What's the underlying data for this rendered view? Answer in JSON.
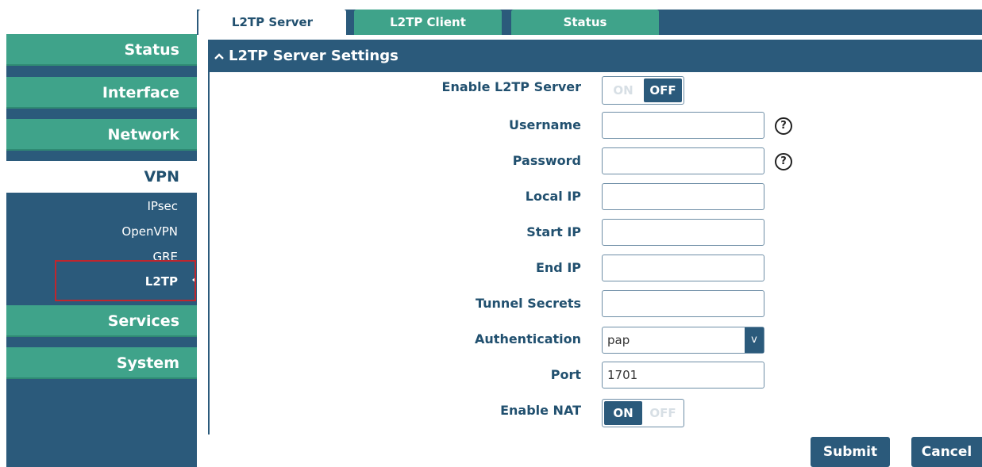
{
  "sidebar": {
    "items": [
      {
        "label": "Status"
      },
      {
        "label": "Interface"
      },
      {
        "label": "Network"
      },
      {
        "label": "VPN"
      },
      {
        "label": "Services"
      },
      {
        "label": "System"
      }
    ],
    "vpn_sub": [
      {
        "label": "IPsec"
      },
      {
        "label": "OpenVPN"
      },
      {
        "label": "GRE"
      },
      {
        "label": "L2TP"
      }
    ]
  },
  "tabs": [
    {
      "label": "L2TP Server"
    },
    {
      "label": "L2TP Client"
    },
    {
      "label": "Status"
    }
  ],
  "section": {
    "title": "L2TP Server Settings",
    "icon": "chevron-up-icon"
  },
  "form": {
    "enable_server": {
      "label": "Enable L2TP Server",
      "on": "ON",
      "off": "OFF",
      "state": "OFF"
    },
    "username": {
      "label": "Username",
      "value": ""
    },
    "password": {
      "label": "Password",
      "value": ""
    },
    "local_ip": {
      "label": "Local IP",
      "value": ""
    },
    "start_ip": {
      "label": "Start IP",
      "value": ""
    },
    "end_ip": {
      "label": "End IP",
      "value": ""
    },
    "tunnel_secrets": {
      "label": "Tunnel Secrets",
      "value": ""
    },
    "authentication": {
      "label": "Authentication",
      "value": "pap"
    },
    "port": {
      "label": "Port",
      "value": "1701"
    },
    "enable_nat": {
      "label": "Enable NAT",
      "on": "ON",
      "off": "OFF",
      "state": "ON"
    },
    "help_glyph": "?"
  },
  "actions": {
    "submit": "Submit",
    "cancel": "Cancel"
  },
  "colors": {
    "primary": "#2b5a7b",
    "accent": "#3fa38a",
    "highlight": "#c0262d"
  }
}
